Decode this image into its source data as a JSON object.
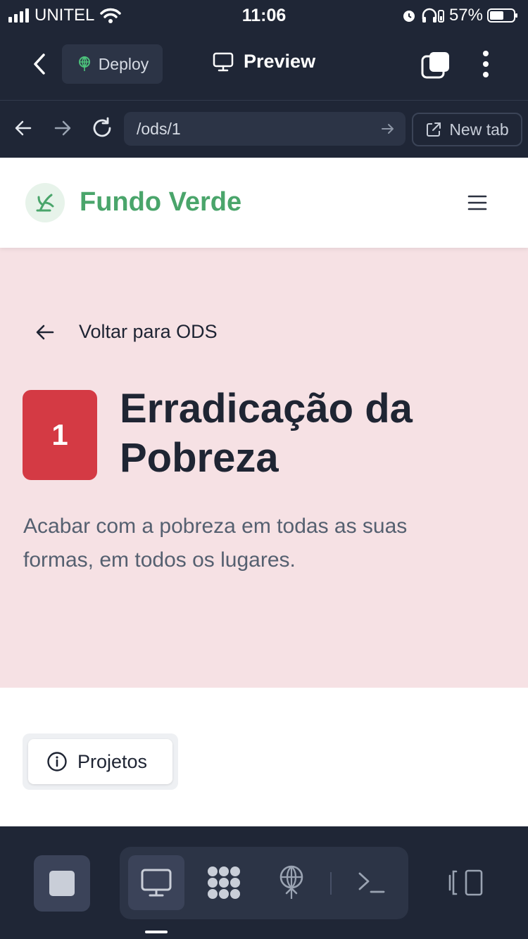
{
  "status_bar": {
    "carrier": "UNITEL",
    "time": "11:06",
    "battery": "57%"
  },
  "toolbar": {
    "deploy_label": "Deploy",
    "preview_label": "Preview"
  },
  "url_bar": {
    "path": "/ods/1",
    "new_tab_label": "New tab"
  },
  "site": {
    "brand": "Fundo Verde",
    "back_label": "Voltar para ODS",
    "goal_number": "1",
    "goal_title": "Erradicação da Pobreza",
    "goal_description": "Acabar com a pobreza em todas as suas formas, em todos os lugares.",
    "tab_projects": "Projetos"
  },
  "colors": {
    "brand": "#4aa56b",
    "goal_badge": "#d43a44",
    "hero_bg": "#f6e1e4",
    "chrome_bg": "#1f2636"
  }
}
